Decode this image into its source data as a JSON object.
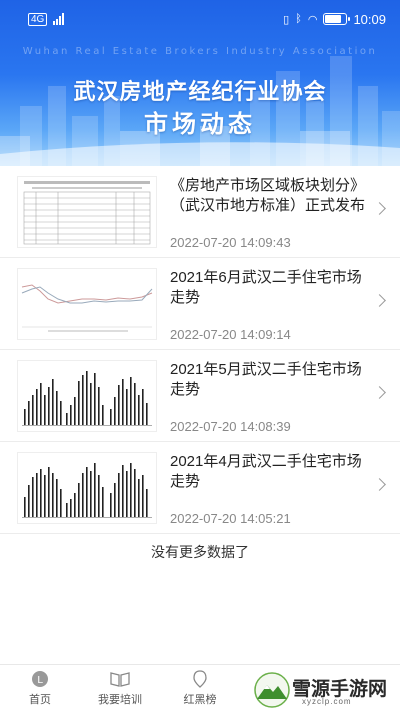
{
  "status_bar": {
    "time": "10:09",
    "network": "4G"
  },
  "header": {
    "english_line": "Wuhan  Real Estate Brokers Industry Association",
    "title_line1": "武汉房地产经纪行业协会",
    "title_line2": "市场动态"
  },
  "articles": [
    {
      "title": "《房地产市场区域板块划分》（武汉市地方标准）正式发布",
      "date": "2022-07-20 14:09:43",
      "thumb": "table-thumbnail-icon"
    },
    {
      "title": "2021年6月武汉二手住宅市场走势",
      "date": "2022-07-20 14:09:14",
      "thumb": "line-chart-thumbnail-icon"
    },
    {
      "title": "2021年5月武汉二手住宅市场走势",
      "date": "2022-07-20 14:08:39",
      "thumb": "bar-chart-thumbnail-icon"
    },
    {
      "title": "2021年4月武汉二手住宅市场走势",
      "date": "2022-07-20 14:05:21",
      "thumb": "bar-chart-thumbnail-icon"
    }
  ],
  "no_more_text": "没有更多数据了",
  "bottom_nav": [
    {
      "label": "首页",
      "icon": "home-icon"
    },
    {
      "label": "我要培训",
      "icon": "book-icon"
    },
    {
      "label": "红黑榜",
      "icon": "list-icon"
    }
  ],
  "watermark": {
    "name": "雪源手游网",
    "url": "xyzclp.com"
  },
  "colors": {
    "banner_top": "#1f63e6",
    "banner_bottom": "#9cd0fb",
    "date_text": "#888888"
  }
}
